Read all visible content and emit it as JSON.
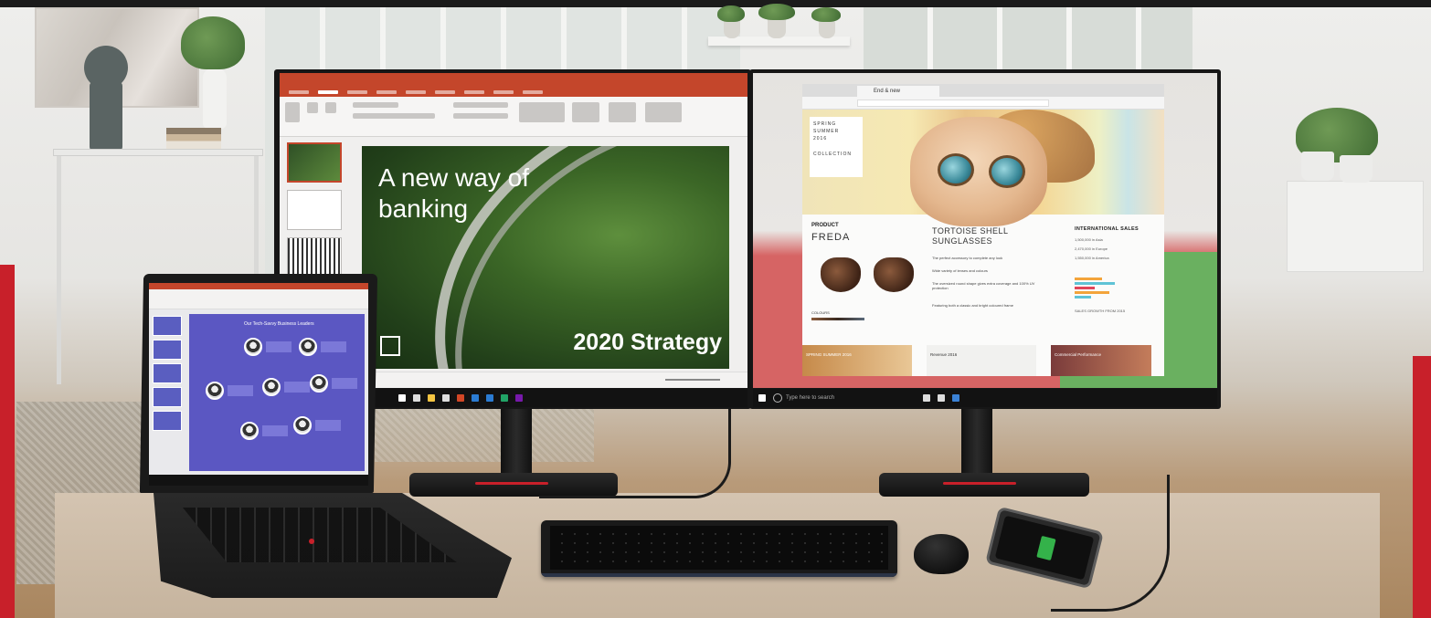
{
  "scene": {
    "description_colors": {
      "accent_red": "#c8202a",
      "ppt_orange": "#c4462b",
      "taskbar": "#121212"
    }
  },
  "left_monitor": {
    "app": "PowerPoint",
    "slide": {
      "title": "A new way of banking",
      "subtitle": "2020 Strategy"
    },
    "taskbar_icons": [
      "file-explorer-icon",
      "store-icon",
      "powerpoint-icon",
      "word-icon",
      "excel-icon",
      "onenote-icon"
    ]
  },
  "right_monitor": {
    "app": "Microsoft Edge",
    "tab_label": "End & new",
    "hero": {
      "season_lines": [
        "SPRING",
        "SUMMER",
        "2016"
      ],
      "collection": "COLLECTION"
    },
    "product": {
      "label": "PRODUCT",
      "name": "FREDA",
      "colour_label": "COLOURS"
    },
    "tortoise": {
      "title": "TORTOISE SHELL SUNGLASSES",
      "bullets": [
        "The perfect accessory to complete any look",
        "Wide variety of lenses and colours",
        "The oversized round shape gives extra coverage and 100% UV protection",
        "Featuring both a classic and bright coloured frame"
      ]
    },
    "international": {
      "title": "INTERNATIONAL SALES",
      "items": [
        "1,500,000 in Asia",
        "2,470,000 in Europe",
        "1,550,000 in America"
      ],
      "sales_label": "SALES GROWTH FROM 2015"
    },
    "tiles": [
      {
        "text": "SPRING SUMMER 2016"
      },
      {
        "text": "Revenue 2016"
      },
      {
        "text": "Commercial Performance"
      }
    ],
    "search_placeholder": "Type here to search"
  },
  "laptop": {
    "slide_title": "Our Tech-Savvy Business Leaders"
  },
  "phone": {
    "status_icon": "battery-charging-icon"
  }
}
